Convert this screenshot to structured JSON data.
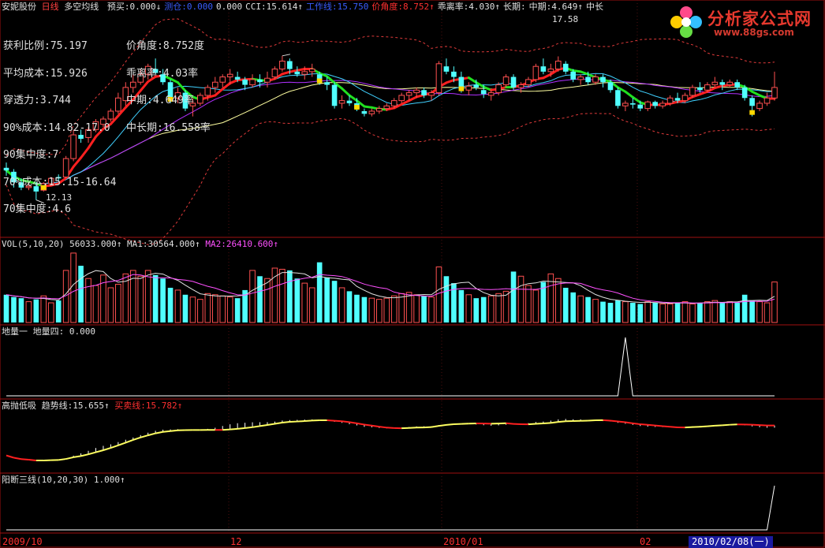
{
  "stock": {
    "name": "安妮股份",
    "period": "日线",
    "indicator": "多空均线"
  },
  "header1": [
    {
      "label": "预买:",
      "value": "0.000↓",
      "color": "#e0e0e0"
    },
    {
      "label": "测仓:",
      "value": "0.000",
      "color": "#3a5dff"
    },
    {
      "label": "",
      "value": "0.000",
      "color": "#e0e0e0"
    },
    {
      "label": "CCI:",
      "value": "15.614↑",
      "color": "#e0e0e0"
    },
    {
      "label": "工作线:",
      "value": "15.750",
      "color": "#3a5dff"
    },
    {
      "label": "价角度:",
      "value": "8.752↑",
      "color": "#ff3030"
    },
    {
      "label": "乖离率:",
      "value": "4.030↑",
      "color": "#e0e0e0"
    },
    {
      "label": "长期:",
      "value": "",
      "color": "#e0e0e0"
    },
    {
      "label": "中期:",
      "value": "4.649↑",
      "color": "#e0e0e0"
    },
    {
      "label": "中长",
      "value": "",
      "color": "#e0e0e0"
    }
  ],
  "stats_left": [
    "获利比例:75.197",
    "平均成本:15.926",
    "穿透力:3.744",
    "90%成本:14.82-17.0",
    "90集中度:7",
    "70%成本:15.15-16.64",
    "70集中度:4.6"
  ],
  "stats_right": [
    "价角度:8.752度",
    "乖离率:4.03率",
    "中期:4.649率",
    "中长期:16.558率"
  ],
  "price_high_label": "17.58",
  "price_low_label": "12.13",
  "vol_header": {
    "title": "VOL(5,10,20)",
    "vol": "56033.000↑",
    "ma1_label": "MA1:",
    "ma1": "30564.000↑",
    "ma2_label": "MA2:",
    "ma2": "26410.600↑"
  },
  "dl_header": {
    "title": "地量一",
    "sub": "地量四:",
    "value": "0.000"
  },
  "gp_header": {
    "title": "高抛低吸",
    "trend_label": "趋势线:",
    "trend": "15.655↑",
    "sell_label": "买卖线:",
    "sell": "15.782↑"
  },
  "yd_header": {
    "title": "阳断三线(10,20,30)",
    "value": "1.000↑"
  },
  "x_axis": [
    {
      "label": "2009/10"
    },
    {
      "label": "12"
    },
    {
      "label": "2010/01"
    },
    {
      "label": "02"
    },
    {
      "label": "2010/02/08(一)",
      "highlight": true
    }
  ],
  "logo": {
    "main": "分析家公式网",
    "url": "www.88gs.com"
  },
  "colors": {
    "up": "#ff5050",
    "down": "#50ffff",
    "ma_short_up": "#ff2020",
    "ma_short_down": "#20e020",
    "ma_mid": "#b030ff",
    "ma_long": "#ffffa0",
    "ma_cyan": "#40d0ff",
    "band": "#e03a3a",
    "panel_border": "#a01010"
  },
  "chart_data": {
    "type": "candlestick",
    "candles": [
      [
        13.35,
        13.55,
        13.05,
        13.25
      ],
      [
        13.2,
        13.3,
        12.6,
        12.8
      ],
      [
        12.8,
        12.95,
        12.5,
        12.6
      ],
      [
        12.6,
        12.8,
        12.5,
        12.65
      ],
      [
        12.65,
        12.8,
        12.13,
        12.45
      ],
      [
        12.5,
        12.8,
        12.45,
        12.75
      ],
      [
        12.75,
        13.0,
        12.7,
        12.95
      ],
      [
        13.0,
        13.1,
        12.85,
        12.95
      ],
      [
        13.0,
        13.8,
        12.95,
        13.7
      ],
      [
        13.7,
        14.8,
        13.6,
        14.6
      ],
      [
        14.6,
        14.8,
        14.3,
        14.45
      ],
      [
        14.5,
        14.9,
        14.3,
        14.8
      ],
      [
        14.8,
        15.2,
        14.7,
        15.1
      ],
      [
        15.0,
        15.3,
        14.9,
        15.2
      ],
      [
        15.2,
        15.6,
        15.1,
        15.5
      ],
      [
        15.5,
        16.2,
        15.4,
        16.0
      ],
      [
        15.9,
        16.6,
        15.7,
        16.4
      ],
      [
        16.4,
        16.9,
        16.2,
        16.6
      ],
      [
        16.6,
        17.1,
        16.5,
        16.9
      ],
      [
        16.9,
        17.3,
        16.7,
        17.2
      ],
      [
        17.1,
        17.5,
        16.9,
        16.95
      ],
      [
        16.9,
        17.1,
        16.5,
        16.6
      ],
      [
        16.6,
        16.7,
        15.8,
        16.0
      ],
      [
        16.0,
        16.4,
        15.8,
        16.2
      ],
      [
        16.2,
        16.3,
        15.5,
        15.6
      ],
      [
        15.7,
        16.0,
        15.3,
        15.8
      ],
      [
        15.8,
        16.2,
        15.7,
        16.1
      ],
      [
        16.1,
        16.5,
        15.9,
        16.4
      ],
      [
        16.4,
        16.8,
        16.2,
        16.6
      ],
      [
        16.6,
        16.9,
        16.4,
        16.8
      ],
      [
        16.8,
        17.1,
        16.5,
        16.9
      ],
      [
        16.8,
        17.0,
        16.6,
        16.7
      ],
      [
        16.7,
        16.8,
        16.3,
        16.5
      ],
      [
        16.5,
        16.9,
        16.4,
        16.7
      ],
      [
        16.7,
        16.9,
        16.4,
        16.6
      ],
      [
        16.6,
        17.0,
        16.4,
        16.75
      ],
      [
        16.8,
        17.2,
        16.7,
        17.1
      ],
      [
        17.1,
        17.6,
        17.0,
        17.4
      ],
      [
        17.4,
        17.5,
        16.9,
        17.1
      ],
      [
        17.0,
        17.2,
        16.8,
        16.9
      ],
      [
        16.9,
        17.2,
        16.7,
        17.0
      ],
      [
        17.0,
        17.3,
        16.8,
        17.1
      ],
      [
        16.9,
        17.0,
        16.5,
        16.6
      ],
      [
        16.6,
        16.8,
        16.3,
        16.5
      ],
      [
        16.5,
        16.6,
        15.6,
        15.7
      ],
      [
        15.8,
        16.1,
        15.6,
        15.9
      ],
      [
        15.9,
        16.1,
        15.7,
        15.8
      ],
      [
        15.8,
        16.0,
        15.5,
        15.6
      ],
      [
        15.5,
        15.6,
        15.3,
        15.4
      ],
      [
        15.4,
        15.6,
        15.3,
        15.5
      ],
      [
        15.5,
        15.7,
        15.4,
        15.6
      ],
      [
        15.6,
        15.8,
        15.5,
        15.7
      ],
      [
        15.7,
        16.0,
        15.6,
        15.9
      ],
      [
        15.9,
        16.2,
        15.8,
        16.1
      ],
      [
        16.1,
        16.3,
        15.9,
        16.2
      ],
      [
        16.2,
        16.4,
        16.0,
        16.3
      ],
      [
        16.3,
        16.4,
        16.0,
        16.1
      ],
      [
        16.1,
        16.3,
        15.9,
        16.2
      ],
      [
        16.2,
        17.4,
        16.1,
        17.3
      ],
      [
        17.2,
        17.5,
        16.9,
        17.0
      ],
      [
        17.0,
        17.2,
        16.6,
        16.8
      ],
      [
        16.8,
        17.0,
        16.2,
        16.3
      ],
      [
        16.3,
        16.6,
        16.1,
        16.45
      ],
      [
        16.5,
        16.7,
        16.3,
        16.4
      ],
      [
        16.3,
        16.5,
        16.0,
        16.15
      ],
      [
        16.1,
        16.3,
        15.9,
        16.2
      ],
      [
        16.2,
        16.6,
        16.1,
        16.5
      ],
      [
        16.5,
        16.9,
        16.4,
        16.8
      ],
      [
        16.8,
        16.9,
        16.3,
        16.4
      ],
      [
        16.4,
        16.6,
        16.2,
        16.5
      ],
      [
        16.5,
        16.8,
        16.4,
        16.7
      ],
      [
        16.7,
        17.3,
        16.6,
        17.2
      ],
      [
        17.2,
        17.5,
        16.9,
        17.0
      ],
      [
        17.0,
        17.3,
        16.8,
        17.1
      ],
      [
        17.1,
        17.58,
        17.0,
        17.4
      ],
      [
        17.3,
        17.4,
        16.9,
        17.0
      ],
      [
        17.0,
        17.1,
        16.6,
        16.7
      ],
      [
        16.7,
        16.9,
        16.5,
        16.8
      ],
      [
        16.8,
        17.0,
        16.5,
        16.6
      ],
      [
        16.6,
        16.9,
        16.5,
        16.8
      ],
      [
        16.8,
        16.9,
        16.4,
        16.6
      ],
      [
        16.6,
        16.7,
        16.2,
        16.3
      ],
      [
        16.3,
        16.4,
        15.6,
        15.7
      ],
      [
        15.7,
        15.9,
        15.5,
        15.8
      ],
      [
        15.8,
        16.0,
        15.6,
        15.75
      ],
      [
        15.75,
        15.9,
        15.5,
        15.6
      ],
      [
        15.6,
        15.9,
        15.5,
        15.85
      ],
      [
        15.85,
        15.9,
        15.6,
        15.7
      ],
      [
        15.7,
        15.9,
        15.6,
        15.8
      ],
      [
        15.8,
        16.1,
        15.7,
        16.0
      ],
      [
        16.0,
        16.2,
        15.8,
        15.9
      ],
      [
        15.9,
        16.2,
        15.8,
        16.1
      ],
      [
        16.1,
        16.5,
        16.0,
        16.4
      ],
      [
        16.4,
        16.6,
        16.2,
        16.3
      ],
      [
        16.3,
        16.6,
        16.2,
        16.5
      ],
      [
        16.5,
        16.8,
        16.4,
        16.6
      ],
      [
        16.6,
        16.7,
        16.3,
        16.5
      ],
      [
        16.5,
        16.7,
        16.4,
        16.6
      ],
      [
        16.6,
        16.7,
        16.3,
        16.4
      ],
      [
        16.4,
        16.5,
        15.9,
        16.0
      ],
      [
        16.0,
        16.1,
        15.3,
        15.7
      ],
      [
        15.6,
        15.9,
        15.5,
        15.8
      ],
      [
        15.8,
        16.2,
        15.7,
        16.0
      ],
      [
        16.0,
        17.0,
        15.9,
        16.4
      ]
    ],
    "volumes": [
      24000,
      22000,
      21000,
      18000,
      20000,
      23000,
      17000,
      19000,
      45000,
      60000,
      49000,
      38000,
      32000,
      41000,
      30000,
      33000,
      42000,
      45000,
      40000,
      45000,
      41000,
      38000,
      30000,
      28000,
      24000,
      22000,
      20000,
      25000,
      24000,
      23000,
      22000,
      21000,
      28000,
      45000,
      40000,
      38000,
      47000,
      46000,
      45000,
      38000,
      34000,
      30000,
      52000,
      39000,
      36000,
      30000,
      27000,
      24000,
      22000,
      21000,
      20000,
      21000,
      23000,
      25000,
      26000,
      24000,
      23000,
      22000,
      48000,
      40000,
      34000,
      28000,
      24000,
      21000,
      22000,
      23000,
      25000,
      27000,
      44000,
      40000,
      32000,
      28000,
      35000,
      42000,
      38000,
      30000,
      26000,
      23000,
      22000,
      20000,
      18000,
      17000,
      19000,
      18000,
      17000,
      16000,
      18000,
      17000,
      16000,
      16000,
      17000,
      18000,
      16000,
      17000,
      18000,
      19000,
      17000,
      18000,
      17000,
      24000,
      19000,
      18000,
      17000,
      35000
    ],
    "dl_values": {
      "baseline": 0,
      "spike_index": 83,
      "spike_value": 1
    },
    "yd_values": {
      "baseline": 0,
      "last_value": 1
    }
  }
}
